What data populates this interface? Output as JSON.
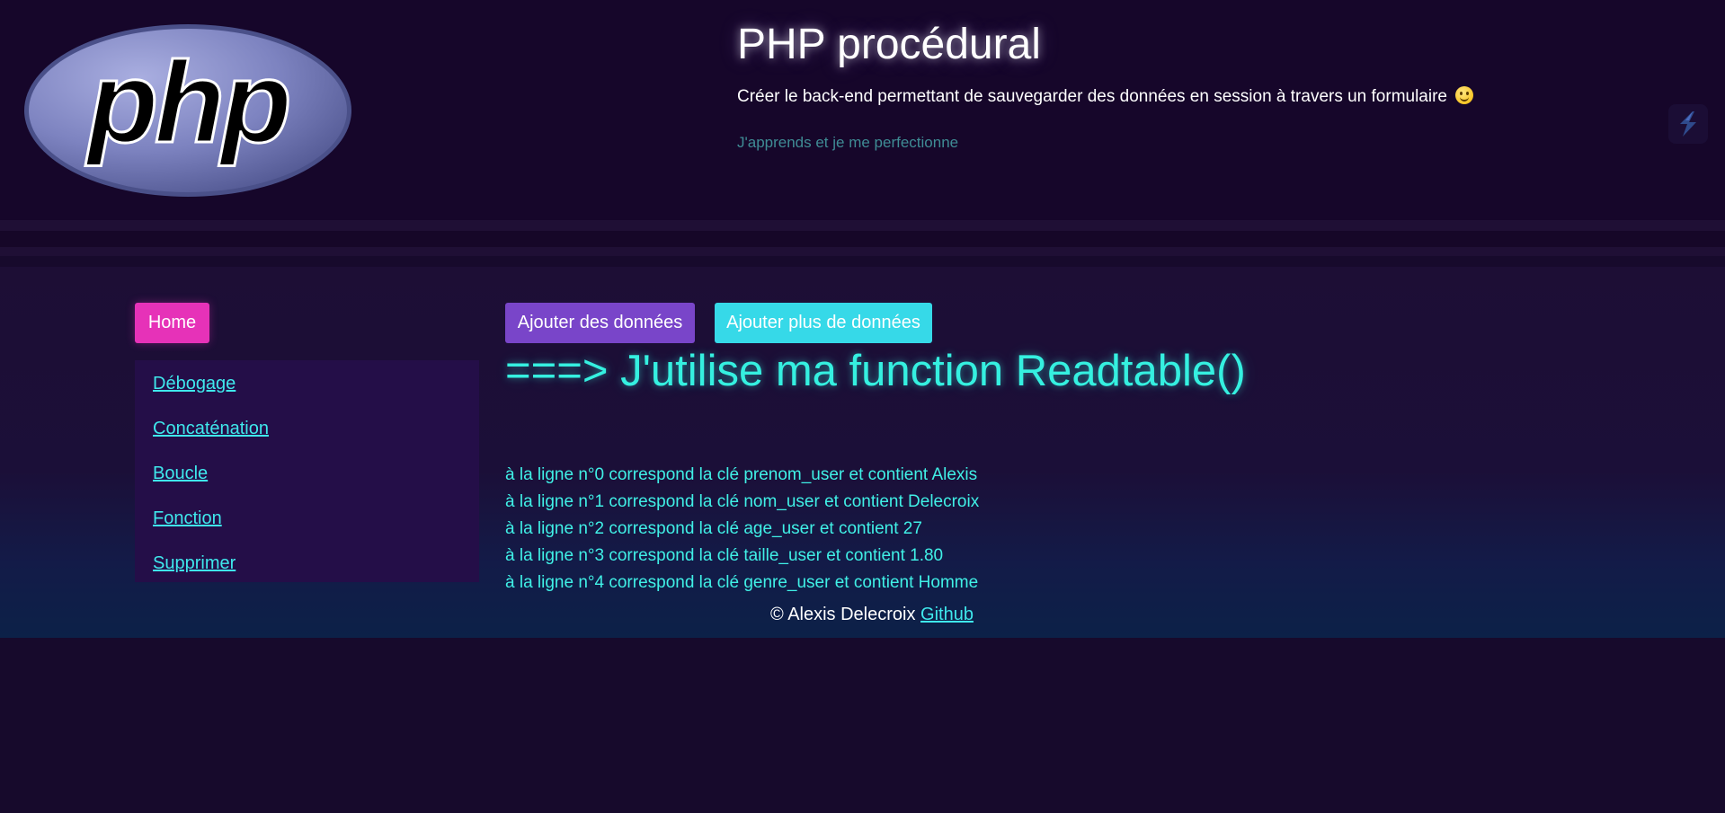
{
  "header": {
    "logo_text": "php",
    "title": "PHP procédural",
    "subtitle": "Créer le back-end permettant de sauvegarder des données en session à travers un formulaire",
    "tagline": "J'apprends et je me perfectionne",
    "emoji_icon": "smiley-icon",
    "theme_toggle_icon": "bolt-icon"
  },
  "sidebar": {
    "home_label": "Home",
    "items": [
      {
        "label": "Débogage"
      },
      {
        "label": "Concaténation"
      },
      {
        "label": "Boucle"
      },
      {
        "label": "Fonction"
      },
      {
        "label": "Supprimer"
      }
    ]
  },
  "main": {
    "buttons": {
      "add_label": "Ajouter des données",
      "add_more_label": "Ajouter plus de données"
    },
    "heading": "===> J'utilise ma function Readtable()",
    "lines": [
      "à la ligne n°0 correspond la clé prenom_user et contient Alexis",
      "à la ligne n°1 correspond la clé nom_user et contient Delecroix",
      "à la ligne n°2 correspond la clé age_user et contient 27",
      "à la ligne n°3 correspond la clé taille_user et contient 1.80",
      "à la ligne n°4 correspond la clé genre_user et contient Homme"
    ]
  },
  "footer": {
    "copyright": "© Alexis Delecroix",
    "github_label": "Github"
  },
  "colors": {
    "background": "#170a2c",
    "home_button": "#e632b8",
    "add_button": "#7945c9",
    "add_more_button": "#36d9e8",
    "accent_text": "#35f0e0",
    "nav_panel": "#240e48"
  }
}
